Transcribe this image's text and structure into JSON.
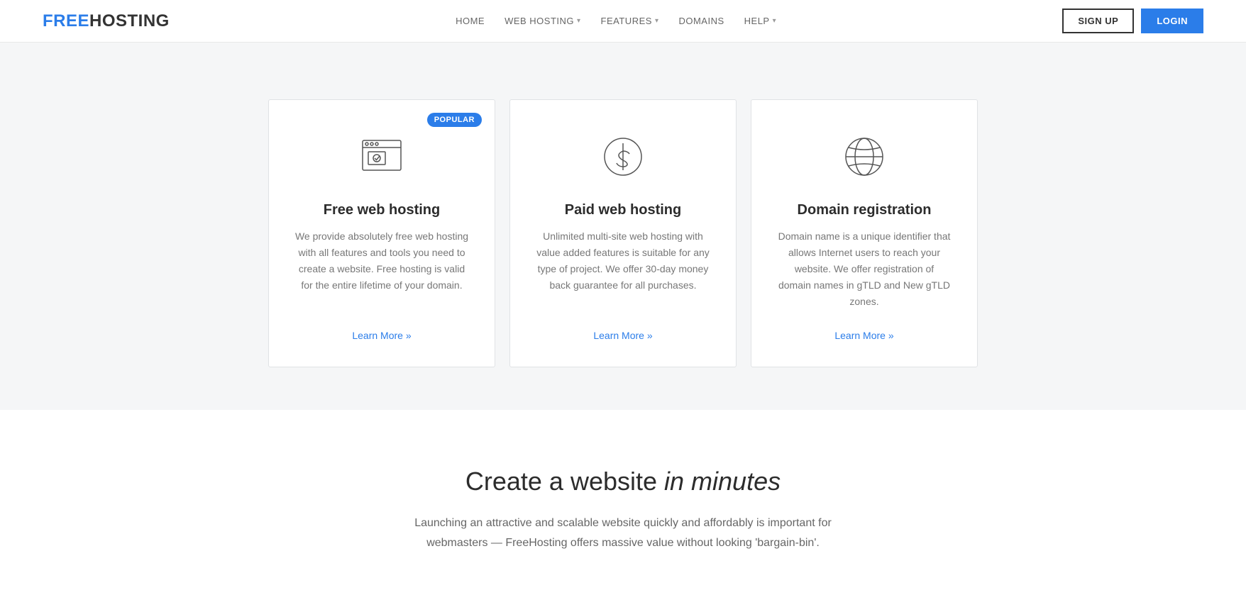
{
  "header": {
    "logo_free": "FREE",
    "logo_hosting": "HOSTING",
    "nav": [
      {
        "label": "HOME",
        "has_dropdown": false
      },
      {
        "label": "WEB HOSTING",
        "has_dropdown": true
      },
      {
        "label": "FEATURES",
        "has_dropdown": true
      },
      {
        "label": "DOMAINS",
        "has_dropdown": false
      },
      {
        "label": "HELP",
        "has_dropdown": true
      }
    ],
    "signup_label": "SIGN UP",
    "login_label": "LOGIN"
  },
  "cards": [
    {
      "id": "free-hosting",
      "title": "Free web hosting",
      "description": "We provide absolutely free web hosting with all features and tools you need to create a website. Free hosting is valid for the entire lifetime of your domain.",
      "link_label": "Learn More »",
      "popular": true,
      "popular_label": "POPULAR",
      "icon": "browser"
    },
    {
      "id": "paid-hosting",
      "title": "Paid web hosting",
      "description": "Unlimited multi-site web hosting with value added features is suitable for any type of project. We offer 30-day money back guarantee for all purchases.",
      "link_label": "Learn More »",
      "popular": false,
      "icon": "dollar"
    },
    {
      "id": "domain-registration",
      "title": "Domain registration",
      "description": "Domain name is a unique identifier that allows Internet users to reach your website. We offer registration of domain names in gTLD and New gTLD zones.",
      "link_label": "Learn More »",
      "popular": false,
      "icon": "globe"
    }
  ],
  "bottom": {
    "title_normal": "Create a website",
    "title_italic": "in minutes",
    "description": "Launching an attractive and scalable website quickly and affordably is important for webmasters — FreeHosting offers massive value without looking 'bargain-bin'."
  }
}
